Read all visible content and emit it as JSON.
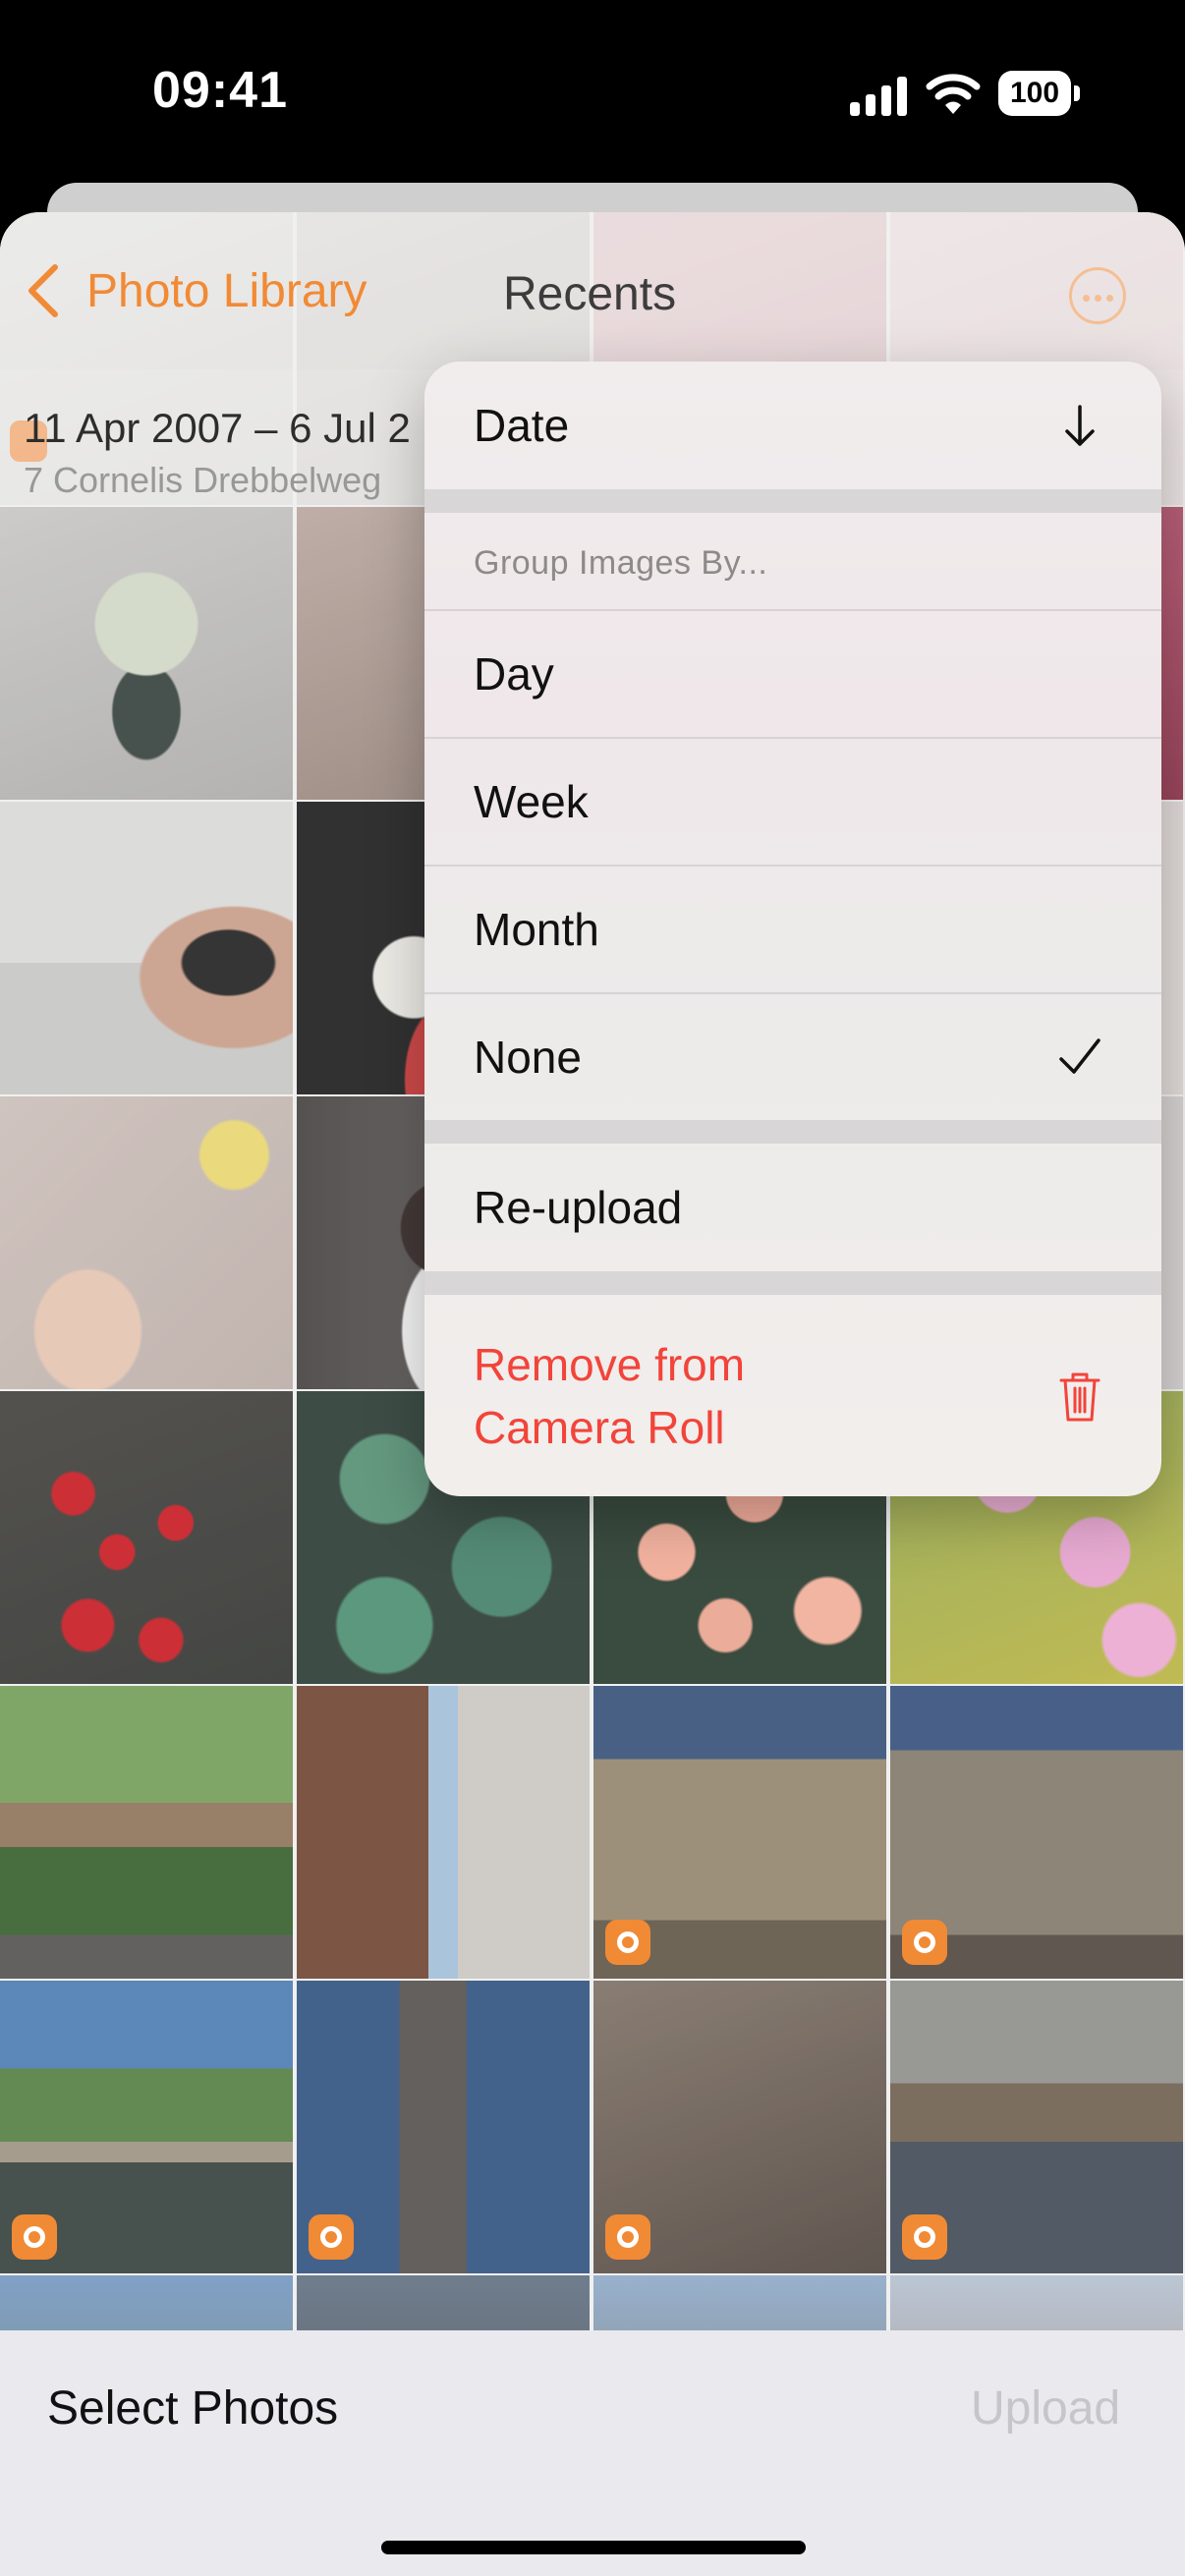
{
  "status_bar": {
    "time": "09:41",
    "battery": "100"
  },
  "nav": {
    "back_label": "Photo Library",
    "title": "Recents"
  },
  "date_header": {
    "range": "11 Apr 2007 – 6 Jul 2",
    "location": "7 Cornelis Drebbelweg"
  },
  "menu": {
    "sort_label": "Date",
    "group_header": "Group Images By...",
    "group_options": [
      {
        "label": "Day",
        "selected": false
      },
      {
        "label": "Week",
        "selected": false
      },
      {
        "label": "Month",
        "selected": false
      },
      {
        "label": "None",
        "selected": true
      }
    ],
    "reupload_label": "Re-upload",
    "remove_label_line1": "Remove from",
    "remove_label_line2": "Camera Roll"
  },
  "bottom_bar": {
    "select_label": "Select Photos",
    "upload_label": "Upload"
  },
  "colors": {
    "accent": "#f07a1a",
    "danger": "#f2443a"
  },
  "photos": [
    "vase-flowers",
    "roses-vase",
    "pink-flowers",
    "pink-flowers-edge",
    "woman-baby-breath",
    "hand-baby-breath",
    "hidden",
    "hidden",
    "hand-bouquet",
    "woman-portrait",
    "hidden",
    "hidden",
    "red-tulips",
    "cactus",
    "peach-roses",
    "pink-daisies",
    "garden-tulips",
    "canal-street",
    "town-hall",
    "brick-building",
    "canal-trees",
    "church-tower",
    "duck-cobbles",
    "canal-reflection",
    "tree-sky",
    "building-top",
    "trees-street",
    "street-houses"
  ]
}
